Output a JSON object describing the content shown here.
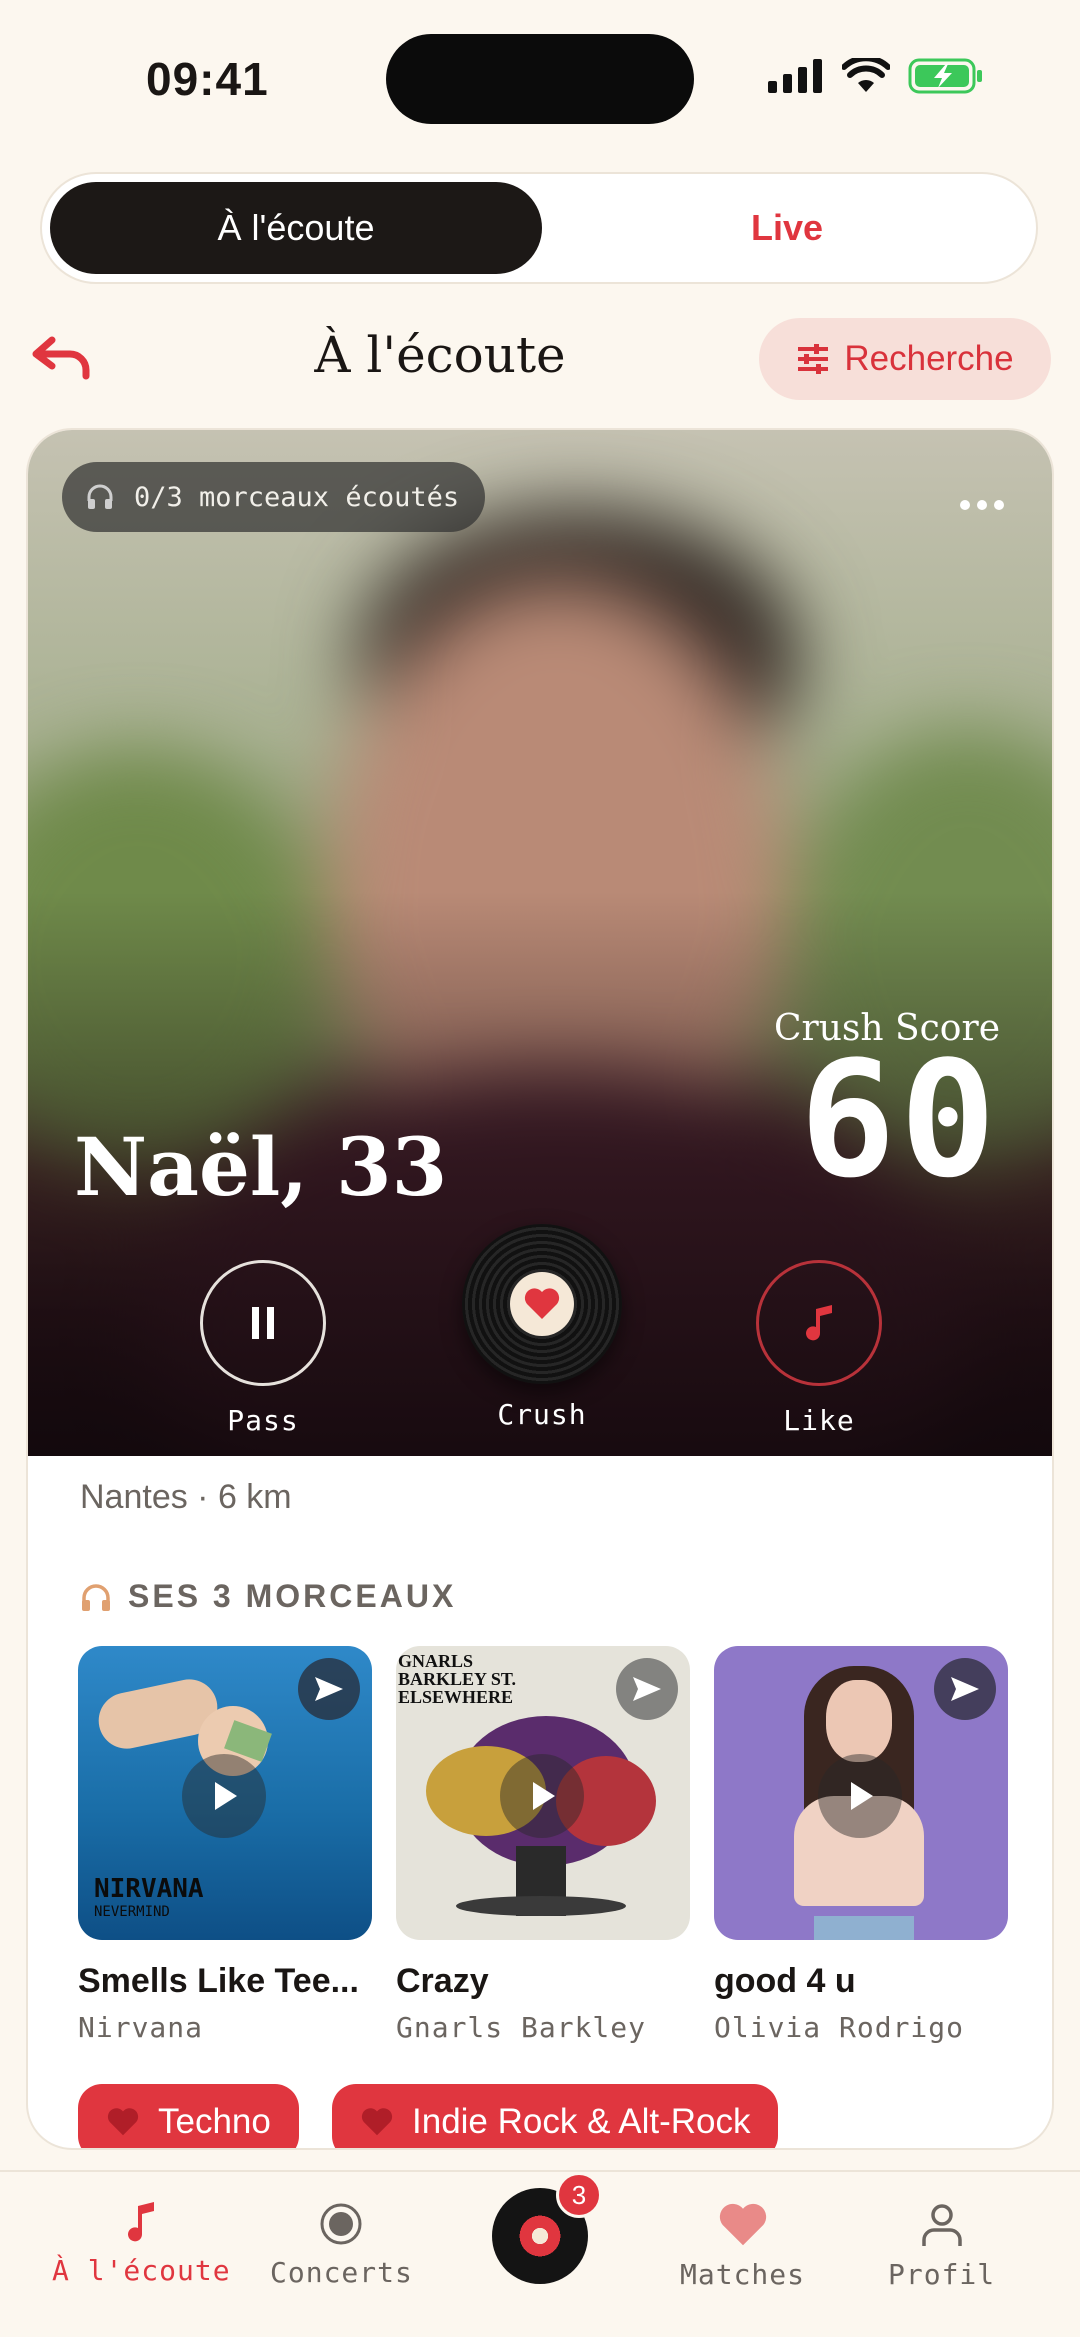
{
  "status_bar": {
    "time": "09:41"
  },
  "segmented": {
    "active": "À l'écoute",
    "inactive": "Live"
  },
  "header": {
    "title": "À l'écoute",
    "search_label": "Recherche"
  },
  "profile": {
    "listened": "0/3 morceaux écoutés",
    "name": "Naël, 33",
    "crush_score_label": "Crush Score",
    "crush_score": "60",
    "location": "Nantes · 6 km"
  },
  "actions": {
    "pass": "Pass",
    "crush": "Crush",
    "like": "Like"
  },
  "tracks_section": {
    "heading": "SES 3 MORCEAUX",
    "tracks": [
      {
        "title": "Smells Like Tee...",
        "artist": "Nirvana",
        "cover_text": "NIRVANA",
        "cover_sub": "NEVERMIND"
      },
      {
        "title": "Crazy",
        "artist": "Gnarls Barkley",
        "cover_text": "GNARLS BARKLEY ST. ELSEWHERE"
      },
      {
        "title": "good 4 u",
        "artist": "Olivia Rodrigo"
      }
    ]
  },
  "tags": [
    "Techno",
    "Indie Rock & Alt-Rock"
  ],
  "tabbar": {
    "listen": "À l'écoute",
    "concerts": "Concerts",
    "badge": "3",
    "matches": "Matches",
    "profile": "Profil"
  },
  "colors": {
    "accent": "#e0363f",
    "background": "#fcf7ef",
    "dark": "#1c1816"
  }
}
